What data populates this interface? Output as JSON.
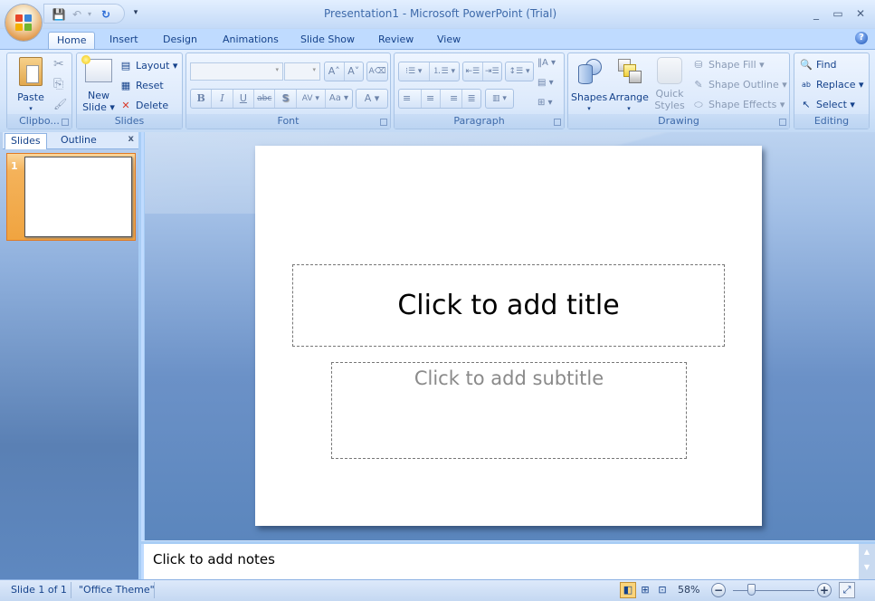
{
  "window": {
    "title": "Presentation1 - Microsoft PowerPoint (Trial)",
    "minimize_glyph": "_",
    "maximize_glyph": "▭",
    "close_glyph": "✕"
  },
  "quick_access": {
    "save_icon": "💾",
    "undo_icon": "↶",
    "undo_dropdown": "▾",
    "redo_icon": "↻",
    "customize_icon": "▾"
  },
  "tabs": [
    {
      "label": "Home",
      "active": true
    },
    {
      "label": "Insert"
    },
    {
      "label": "Design"
    },
    {
      "label": "Animations"
    },
    {
      "label": "Slide Show"
    },
    {
      "label": "Review"
    },
    {
      "label": "View"
    }
  ],
  "help_glyph": "?",
  "ribbon": {
    "clipboard": {
      "label": "Clipbo...",
      "paste": "Paste",
      "cut_icon": "✂",
      "copy_icon": "⎘",
      "format_painter_icon": "🖌"
    },
    "slides": {
      "label": "Slides",
      "new_slide_line1": "New",
      "new_slide_line2": "Slide ▾",
      "layout": "Layout ▾",
      "reset": "Reset",
      "delete": "Delete"
    },
    "font": {
      "label": "Font",
      "font_name": "",
      "font_size": "",
      "grow": "A˄",
      "shrink": "A˅",
      "clear": "A⌫",
      "bold": "B",
      "italic": "I",
      "underline": "U",
      "strike": "abc",
      "shadow": "S",
      "spacing": "AV ▾",
      "case": "Aa ▾",
      "color": "A ▾"
    },
    "paragraph": {
      "label": "Paragraph",
      "bullets": "⁝☰ ▾",
      "numbering": "⒈☰ ▾",
      "decrease_indent": "⇤☰",
      "increase_indent": "⇥☰",
      "line_spacing": "↕☰ ▾",
      "text_direction": "‖A ▾",
      "align_text": "▤ ▾",
      "smartart": "⊞ ▾",
      "align_left": "≡",
      "center": "≡",
      "align_right": "≡",
      "justify": "≣",
      "columns": "▥ ▾"
    },
    "drawing": {
      "label": "Drawing",
      "shapes": "Shapes",
      "arrange": "Arrange",
      "quick_styles_line1": "Quick",
      "quick_styles_line2": "Styles ▾",
      "shape_fill": "Shape Fill ▾",
      "shape_outline": "Shape Outline ▾",
      "shape_effects": "Shape Effects ▾"
    },
    "editing": {
      "label": "Editing",
      "find": "Find",
      "replace": "Replace ▾",
      "select": "Select ▾"
    }
  },
  "left_pane": {
    "tabs": [
      "Slides",
      "Outline"
    ],
    "close_glyph": "x",
    "slides": [
      {
        "number": "1"
      }
    ]
  },
  "slide": {
    "title_placeholder": "Click to add title",
    "subtitle_placeholder": "Click to add subtitle"
  },
  "notes": {
    "placeholder": "Click to add notes"
  },
  "status_bar": {
    "slide_info": "Slide 1 of 1",
    "theme": "\"Office Theme\"",
    "zoom": "58%",
    "zoom_out": "−",
    "zoom_in": "+",
    "view_normal": "◧",
    "view_sorter": "⊞",
    "view_slideshow": "⊡",
    "fit_icon": "⤢"
  },
  "colors": {
    "accent_orange": "#f4b25a",
    "ribbon_text": "#15428b",
    "frame_blue": "#bfdbff"
  }
}
